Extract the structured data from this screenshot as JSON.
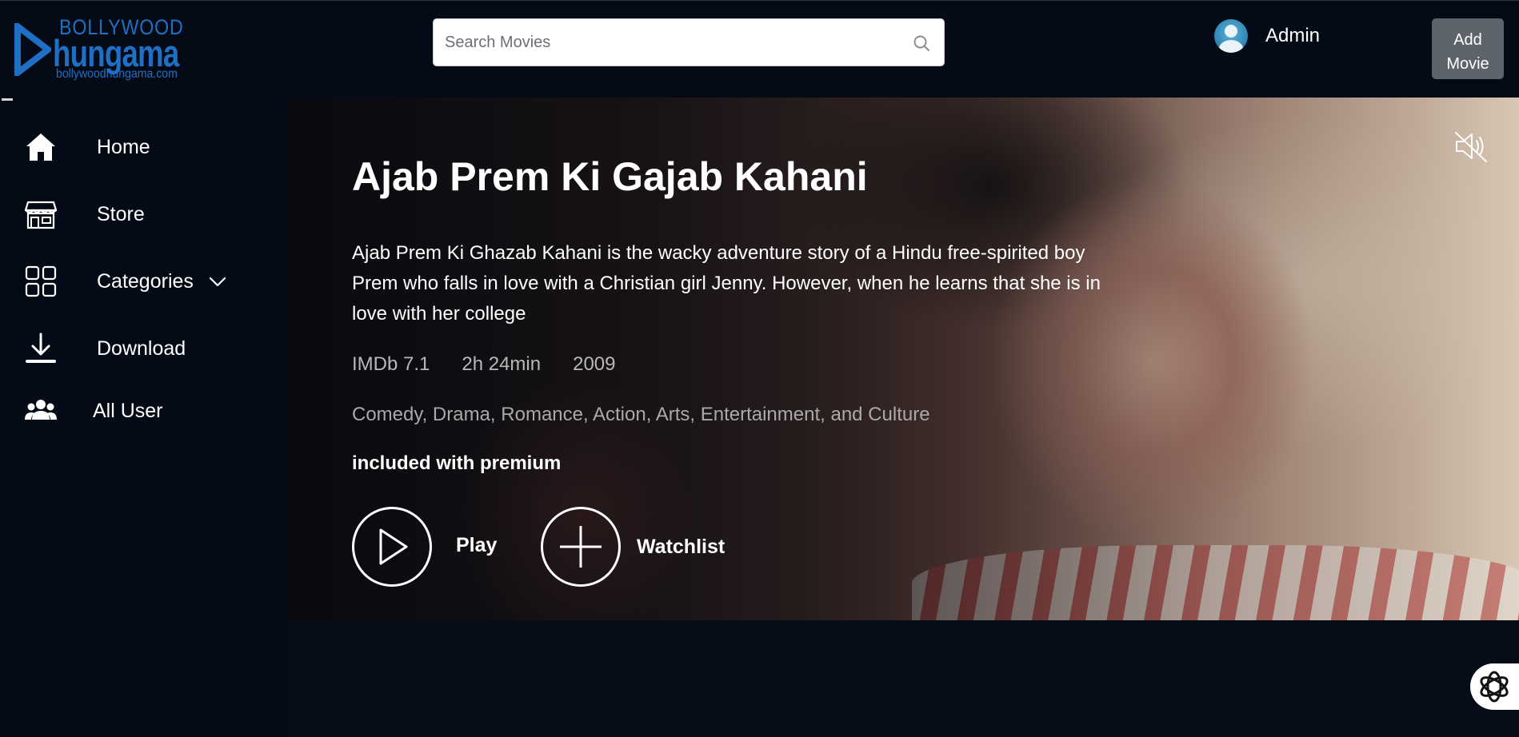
{
  "brand": {
    "top_text": "BOLLYWOOD",
    "main_text": "hungama",
    "url_text": "bollywoodhungama.com",
    "color": "#1f6fc4"
  },
  "search": {
    "placeholder": "Search Movies",
    "value": "",
    "icon": "search-icon"
  },
  "user": {
    "name": "Admin",
    "icon": "avatar"
  },
  "header_actions": {
    "add_movie_label": "Add\nMovie"
  },
  "sidebar": {
    "items": [
      {
        "label": "Home",
        "icon": "home-icon"
      },
      {
        "label": "Store",
        "icon": "store-icon"
      },
      {
        "label": "Categories",
        "icon": "grid-icon",
        "has_dropdown": true
      },
      {
        "label": "Download",
        "icon": "download-icon"
      },
      {
        "label": "All User",
        "icon": "users-icon"
      }
    ]
  },
  "hero": {
    "title": "Ajab Prem Ki Gajab Kahani",
    "description": "Ajab Prem Ki Ghazab Kahani is the wacky adventure story of a Hindu free-spirited boy Prem who falls in love with a Christian girl Jenny. However, when he learns that she is in love with her college",
    "rating": "IMDb 7.1",
    "duration": "2h 24min",
    "year": "2009",
    "genres": "Comedy, Drama, Romance, Action, Arts, Entertainment, and Culture",
    "availability": "included with premium",
    "play_label": "Play",
    "watchlist_label": "Watchlist",
    "mute_icon": "volume-muted-icon"
  },
  "colors": {
    "background": "#070d18",
    "header": "#050b16",
    "button_gray": "#5d636b"
  }
}
